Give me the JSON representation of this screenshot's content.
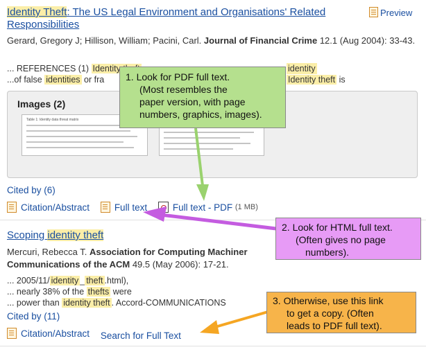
{
  "result1": {
    "title_prefix": "Identity Theft",
    "title_rest": ": The US Legal Environment and Organisations' Related Responsibilities",
    "preview_label": "Preview",
    "authors": "Gerard, Gregory J; Hillison, William; Pacini, Carl.",
    "journal": "Journal of Financial Crime",
    "citation_info": "12.1  (Aug 2004): 33-43.",
    "snippet1": {
      "a": "... REFERENCES (1) ",
      "h1": "Identity theft",
      "b": "",
      "h2": "identity"
    },
    "snippet2": {
      "a": "...of false ",
      "h1": "identities",
      "b": " or fra",
      "h2": "Identity theft",
      "c": " is"
    },
    "images_label": "Images (2)",
    "thumb1_heading": "Table 1: Identity data threat matrix",
    "cited_by": "Cited by (6)",
    "actions": {
      "citation": "Citation/Abstract",
      "full_text": "Full text",
      "full_text_pdf": "Full text - PDF",
      "pdf_size": "(1 MB)"
    }
  },
  "result2": {
    "title_prefix": "Scoping ",
    "title_hl": "identity theft",
    "authors": "Mercuri, Rebecca T.",
    "journal": "Association for Computing Machiner",
    "journal2": "Communications of the ACM",
    "citation_info": "49.5  (May 2006): 17-21.",
    "snippet1": {
      "a": "... 2005/11/",
      "h1": "identity",
      "b": "_",
      "h2": "theft",
      "c": ".html),"
    },
    "snippet2": {
      "a": "... nearly 38% of the ",
      "h1": "thefts",
      "b": " were"
    },
    "snippet3": {
      "a": "... power than ",
      "h1": "identity theft",
      "b": ". Accord-COMMUNICATIONS"
    },
    "cited_by": "Cited by (11)",
    "actions": {
      "citation": "Citation/Abstract",
      "search_full_text": "Search for Full Text"
    }
  },
  "callouts": {
    "c1": {
      "line1": "1. Look for PDF full text.",
      "line2": "(Most resembles the",
      "line3": "paper version, with page",
      "line4": "numbers, graphics, images)."
    },
    "c2": {
      "line1": "2. Look for HTML full text.",
      "line2": "(Often gives no page",
      "line3": "numbers)."
    },
    "c3": {
      "line1": "3. Otherwise, use this link",
      "line2": "to get a copy. (Often",
      "line3": "leads to PDF full text)."
    }
  },
  "colors": {
    "highlight": "#fbeea8",
    "link": "#1a4fa0",
    "callout1": "#b5e08e",
    "callout2": "#e79bf6",
    "callout3": "#f7b44a"
  }
}
